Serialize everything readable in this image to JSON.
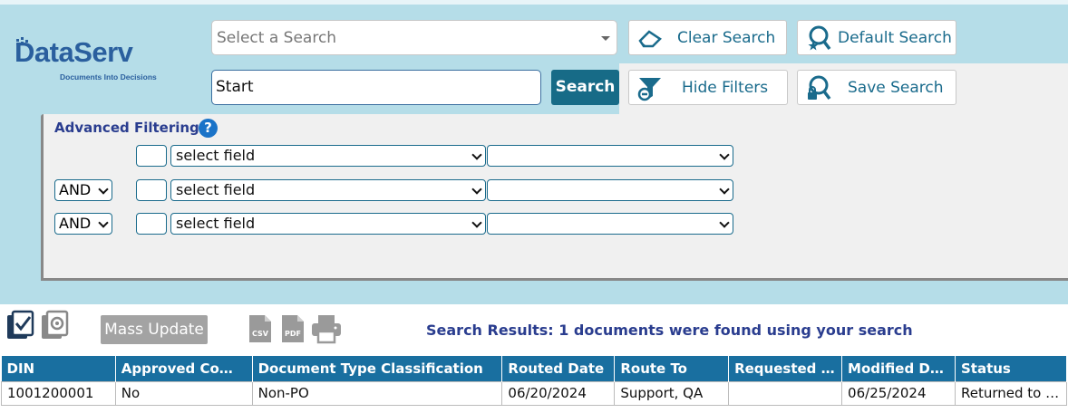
{
  "logo": {
    "name": "DataServ",
    "tagline": "Documents Into Decisions"
  },
  "search": {
    "select_placeholder": "Select a Search",
    "input_value": "Start",
    "search_label": "Search"
  },
  "buttons": {
    "clear_search": "Clear Search",
    "default_search": "Default Search",
    "hide_filters": "Hide Filters",
    "save_search": "Save Search"
  },
  "filters": {
    "title": "Advanced Filtering",
    "help": "?",
    "rows": [
      {
        "operator": "",
        "field": "select field",
        "value": ""
      },
      {
        "operator": "AND",
        "field": "select field",
        "value": ""
      },
      {
        "operator": "AND",
        "field": "select field",
        "value": ""
      }
    ]
  },
  "toolbar": {
    "mass_update": "Mass Update",
    "csv_label": "CSV",
    "pdf_label": "PDF",
    "results_text": "Search Results: 1 documents were found using your search"
  },
  "table": {
    "columns": [
      "DIN",
      "Approved Co…",
      "Document Type Classification",
      "Routed Date",
      "Route To",
      "Requested …",
      "Modified D…",
      "Status"
    ],
    "rows": [
      [
        "1001200001",
        "No",
        "Non-PO",
        "06/20/2024",
        "Support, QA",
        "",
        "06/25/2024",
        "Returned to …"
      ]
    ]
  },
  "colors": {
    "header_bg": "#b5dde8",
    "accent": "#176b87",
    "table_header": "#196fa0",
    "title_blue": "#2a3d8f"
  }
}
